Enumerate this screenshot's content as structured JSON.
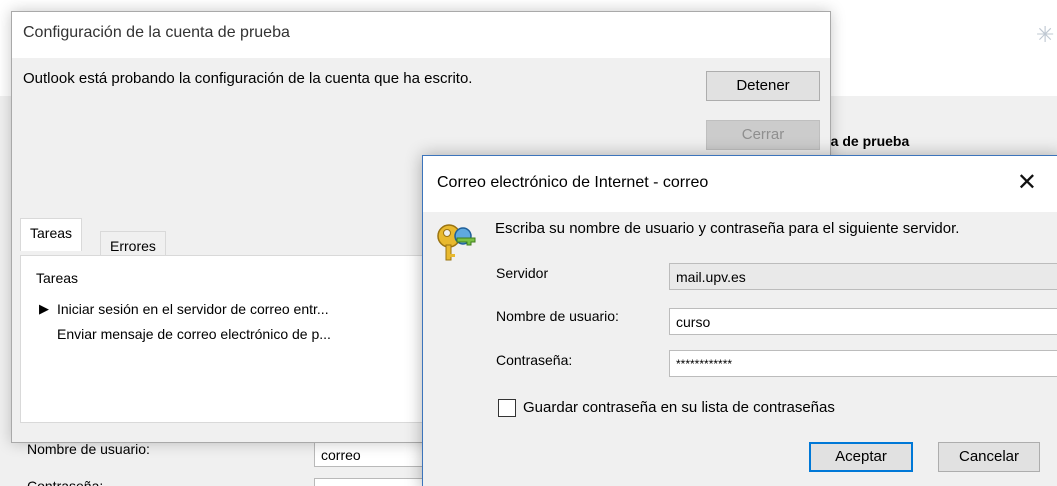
{
  "background": {
    "header_label": "ta de prueba",
    "username_label": "Nombre de usuario:",
    "username_value": "correo",
    "password_label": "Contraseña:",
    "corner_icon": "spinner-icon"
  },
  "test_dialog": {
    "title": "Configuración de la cuenta de prueba",
    "message": "Outlook está probando la configuración de la cuenta que ha escrito.",
    "stop_button": "Detener",
    "close_button": "Cerrar",
    "tabs": [
      {
        "label": "Tareas"
      },
      {
        "label": "Errores"
      }
    ],
    "tasks_header": "Tareas",
    "tasks": [
      {
        "label": "Iniciar sesión en el servidor de correo entr...",
        "icon": "arrow-right-icon"
      },
      {
        "label": "Enviar mensaje de correo electrónico de p...",
        "icon": ""
      }
    ]
  },
  "credentials_dialog": {
    "title": "Correo electrónico de Internet - correo",
    "message": "Escriba su nombre de usuario y contraseña para el siguiente servidor.",
    "server_label": "Servidor",
    "server_value": "mail.upv.es",
    "username_label": "Nombre de usuario:",
    "username_value": "curso",
    "password_label": "Contraseña:",
    "password_value": "************",
    "save_password_label": "Guardar contraseña en su lista de contraseñas",
    "save_password_checked": false,
    "accept_button": "Aceptar",
    "cancel_button": "Cancelar",
    "icon": "keys-icon"
  }
}
